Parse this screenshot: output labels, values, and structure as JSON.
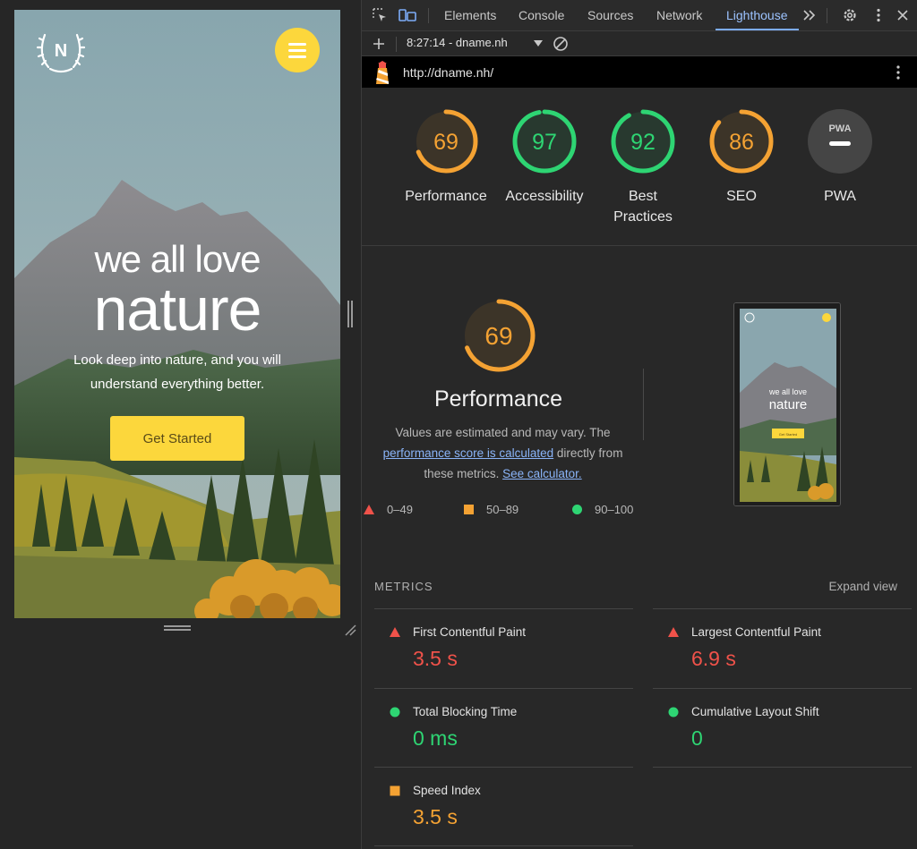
{
  "preview": {
    "logo_letter": "N",
    "hero_small": "we all love",
    "hero_big": "nature",
    "hero_sub": "Look deep into nature, and you will understand everything better.",
    "cta": "Get Started",
    "accent_color": "#fcd73c"
  },
  "devtools": {
    "tabs": [
      "Elements",
      "Console",
      "Sources",
      "Network",
      "Lighthouse"
    ],
    "active_tab": "Lighthouse",
    "more_tabs_icon": "chevron-double-right-icon",
    "run_label": "8:27:14 - dname.nh",
    "url": "http://dname.nh/"
  },
  "scores": [
    {
      "label": "Performance",
      "value": "69",
      "score": 69,
      "color": "#f4a233"
    },
    {
      "label": "Accessibility",
      "value": "97",
      "score": 97,
      "color": "#2ed573"
    },
    {
      "label": "Best Practices",
      "value": "92",
      "score": 92,
      "color": "#2ed573"
    },
    {
      "label": "SEO",
      "value": "86",
      "score": 86,
      "color": "#f4a233"
    },
    {
      "label": "PWA",
      "value": "PWA",
      "score": null,
      "color": "#5a5a5a"
    }
  ],
  "performance": {
    "score": "69",
    "title": "Performance",
    "desc_pre": "Values are estimated and may vary. The",
    "link1": "performance score is calculated",
    "desc_mid": "directly from these metrics.",
    "link2": "See calculator.",
    "legend": [
      {
        "range": "0–49",
        "shape": "triangle",
        "color": "#f0524a"
      },
      {
        "range": "50–89",
        "shape": "square",
        "color": "#f4a233"
      },
      {
        "range": "90–100",
        "shape": "circle",
        "color": "#2ed573"
      }
    ],
    "thumb_small": "we all love",
    "thumb_big": "nature",
    "thumb_cta": "Get Started"
  },
  "metrics": {
    "heading": "METRICS",
    "expand": "Expand view",
    "items": [
      {
        "name": "First Contentful Paint",
        "value": "3.5 s",
        "status": "red"
      },
      {
        "name": "Largest Contentful Paint",
        "value": "6.9 s",
        "status": "red"
      },
      {
        "name": "Total Blocking Time",
        "value": "0 ms",
        "status": "green"
      },
      {
        "name": "Cumulative Layout Shift",
        "value": "0",
        "status": "green"
      },
      {
        "name": "Speed Index",
        "value": "3.5 s",
        "status": "orange"
      }
    ]
  }
}
